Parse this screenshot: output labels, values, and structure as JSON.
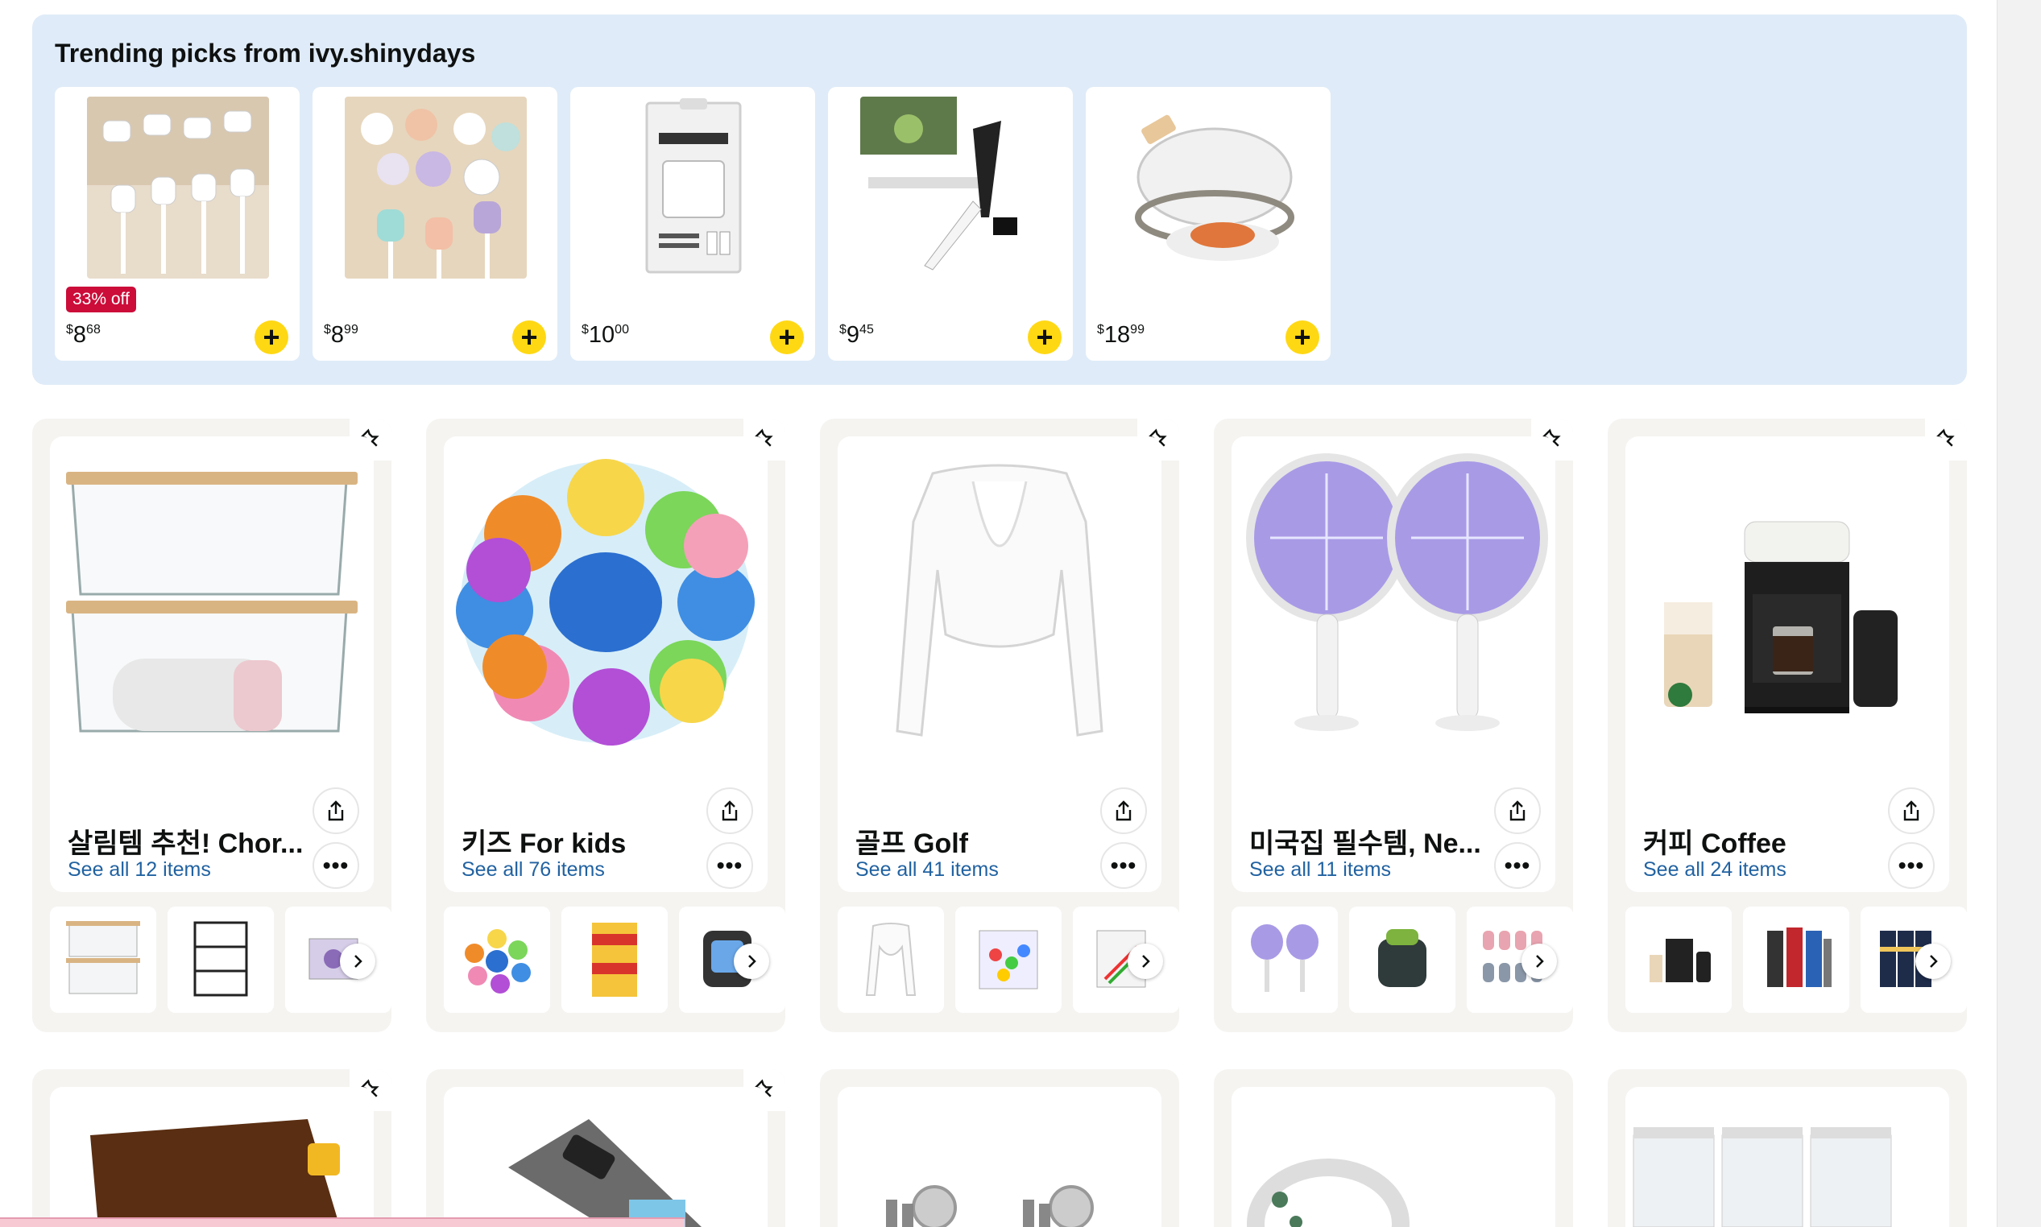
{
  "trending": {
    "title": "Trending picks from ivy.shinydays",
    "items": [
      {
        "badge": "33% off",
        "currency": "$",
        "whole": "8",
        "fraction": "68",
        "icon": "cable-clips-image"
      },
      {
        "badge": "",
        "currency": "$",
        "whole": "8",
        "fraction": "99",
        "icon": "pastel-cable-clips-image"
      },
      {
        "badge": "",
        "currency": "$",
        "whole": "10",
        "fraction": "00",
        "icon": "stanley-boot-set-image"
      },
      {
        "badge": "",
        "currency": "$",
        "whole": "9",
        "fraction": "45",
        "icon": "food-scissors-image"
      },
      {
        "badge": "",
        "currency": "$",
        "whole": "18",
        "fraction": "99",
        "icon": "food-cover-image"
      }
    ],
    "add_label": "+"
  },
  "lists": [
    {
      "name": "살림템 추천! Chor...",
      "see_all": "See all 12 items"
    },
    {
      "name": "키즈 For kids",
      "see_all": "See all 76 items"
    },
    {
      "name": "골프 Golf",
      "see_all": "See all 41 items"
    },
    {
      "name": "미국집 필수템, Ne...",
      "see_all": "See all 11 items"
    },
    {
      "name": "커피 Coffee",
      "see_all": "See all 24 items"
    }
  ],
  "more_label": "•••",
  "colors": {
    "panel": "#dfebf8",
    "link": "#2162a1",
    "add": "#ffd814",
    "badge": "#cc0c39"
  }
}
